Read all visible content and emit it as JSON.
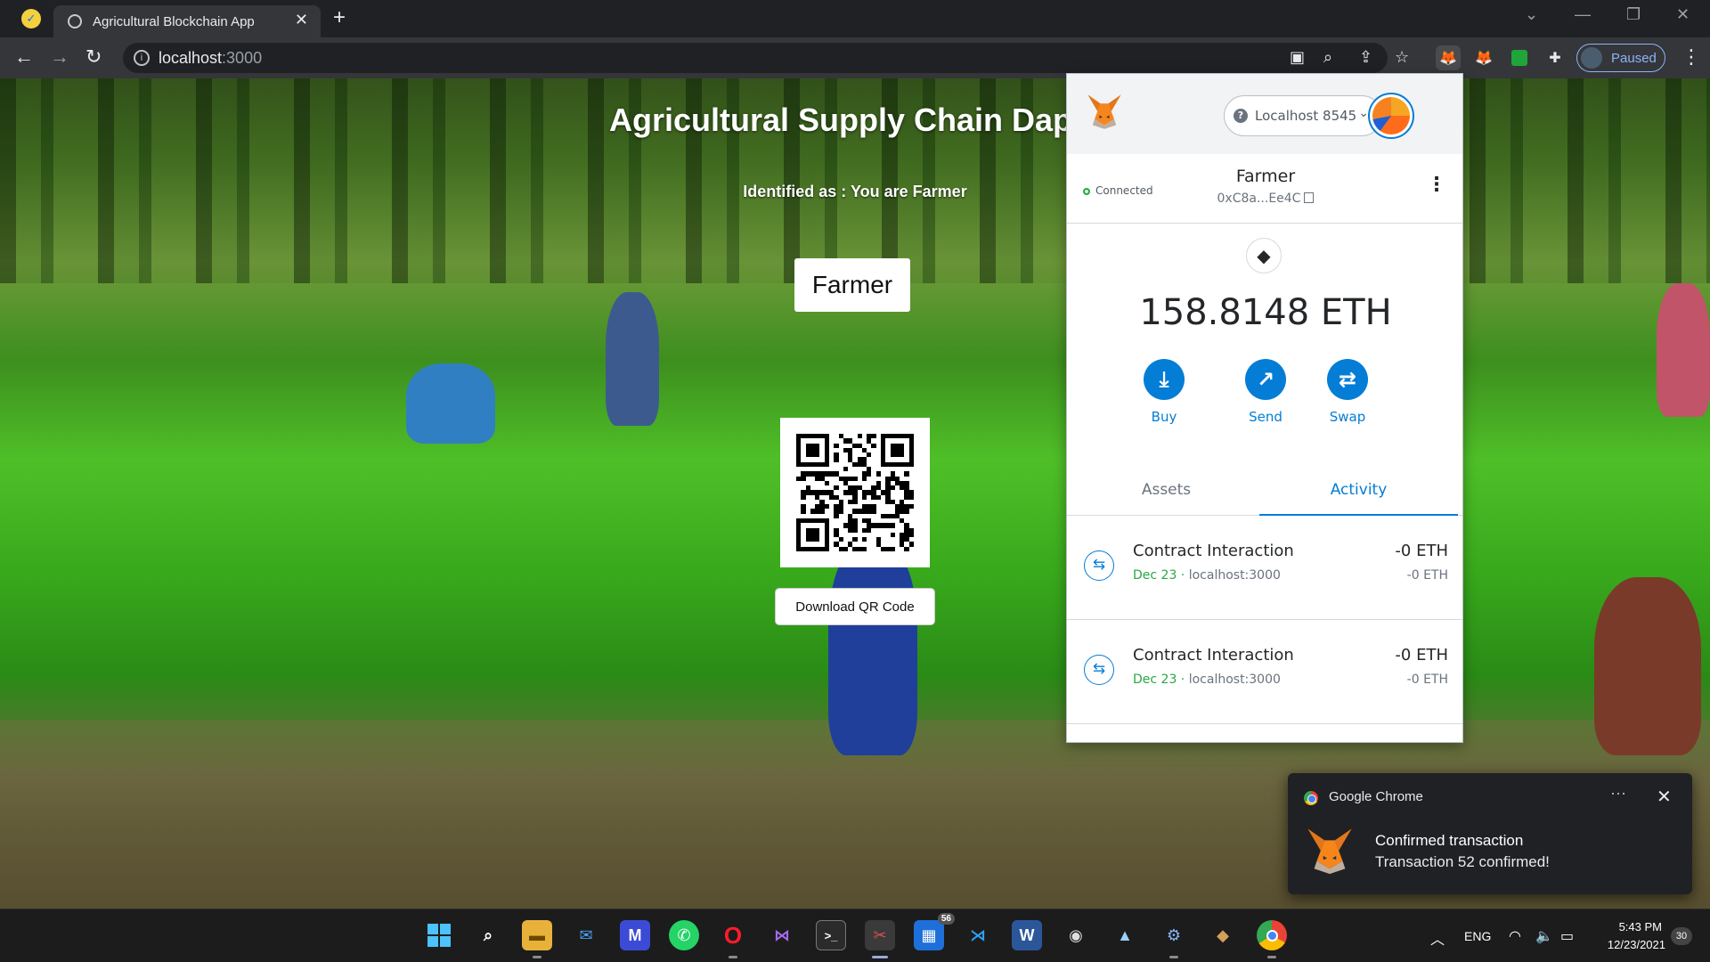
{
  "browser": {
    "tab_title": "Agricultural Blockchain App",
    "url_host": "localhost",
    "url_port": ":3000",
    "profile_label": "Paused"
  },
  "page": {
    "title": "Agricultural Supply Chain Dapp",
    "identified_text": "Identified as : You are Farmer",
    "role_button": "Farmer",
    "qr_download_button": "Download QR Code"
  },
  "metamask": {
    "network": "Localhost 8545",
    "connection_status": "Connected",
    "account_name": "Farmer",
    "account_address": "0xC8a...Ee4C",
    "balance": "158.8148 ETH",
    "actions": [
      {
        "label": "Buy",
        "icon": "download-icon"
      },
      {
        "label": "Send",
        "icon": "arrow-up-right-icon"
      },
      {
        "label": "Swap",
        "icon": "swap-icon"
      }
    ],
    "tabs": [
      "Assets",
      "Activity"
    ],
    "active_tab": "Activity",
    "transactions": [
      {
        "title": "Contract Interaction",
        "date": "Dec 23",
        "origin": "localhost:3000",
        "amount": "-0 ETH",
        "fiat": "-0 ETH"
      },
      {
        "title": "Contract Interaction",
        "date": "Dec 23",
        "origin": "localhost:3000",
        "amount": "-0 ETH",
        "fiat": "-0 ETH"
      }
    ],
    "accent_color": "#037dd6"
  },
  "notification": {
    "app": "Google Chrome",
    "title": "Confirmed transaction",
    "body": "Transaction 52 confirmed!"
  },
  "taskbar": {
    "store_badge": "56",
    "language": "ENG",
    "time": "5:43 PM",
    "date": "12/23/2021",
    "notification_count": "30"
  }
}
